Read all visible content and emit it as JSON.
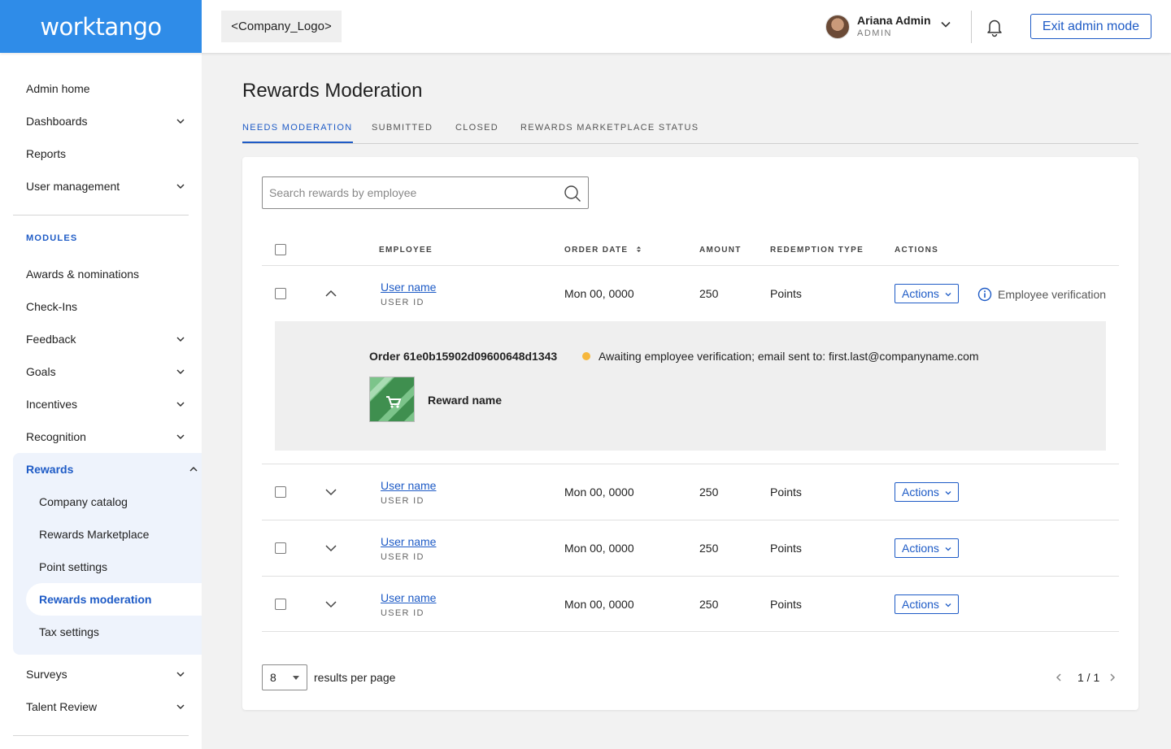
{
  "brand": {
    "name": "worktango"
  },
  "header": {
    "company_logo": "<Company_Logo>",
    "user": {
      "name": "Ariana Admin",
      "role": "ADMIN"
    },
    "exit_label": "Exit admin mode"
  },
  "sidebar": {
    "top_items": [
      {
        "label": "Admin home",
        "has_chevron": false
      },
      {
        "label": "Dashboards",
        "has_chevron": true
      },
      {
        "label": "Reports",
        "has_chevron": false
      },
      {
        "label": "User management",
        "has_chevron": true
      }
    ],
    "modules_label": "MODULES",
    "modules": [
      {
        "label": "Awards & nominations"
      },
      {
        "label": "Check-Ins"
      },
      {
        "label": "Feedback"
      },
      {
        "label": "Goals"
      },
      {
        "label": "Incentives"
      },
      {
        "label": "Recognition"
      }
    ],
    "rewards": {
      "label": "Rewards",
      "children": [
        "Company catalog",
        "Rewards Marketplace",
        "Point settings",
        "Rewards moderation",
        "Tax settings"
      ],
      "active_child": "Rewards moderation"
    },
    "after_items": [
      {
        "label": "Surveys"
      },
      {
        "label": "Talent Review"
      }
    ]
  },
  "page": {
    "title": "Rewards Moderation",
    "tabs": [
      "NEEDS MODERATION",
      "SUBMITTED",
      "CLOSED",
      "REWARDS MARKETPLACE STATUS"
    ],
    "active_tab": "NEEDS MODERATION",
    "search_placeholder": "Search rewards by employee"
  },
  "table": {
    "headers": {
      "employee": "EMPLOYEE",
      "order_date": "ORDER DATE",
      "amount": "AMOUNT",
      "redemption_type": "REDEMPTION TYPE",
      "actions": "ACTIONS"
    },
    "rows": [
      {
        "user_name": "User name",
        "user_id": "USER ID",
        "order_date": "Mon 00, 0000",
        "amount": "250",
        "redemption_type": "Points",
        "actions_label": "Actions",
        "expanded": true,
        "verification_label": "Employee verification"
      },
      {
        "user_name": "User name",
        "user_id": "USER ID",
        "order_date": "Mon 00, 0000",
        "amount": "250",
        "redemption_type": "Points",
        "actions_label": "Actions",
        "expanded": false
      },
      {
        "user_name": "User name",
        "user_id": "USER ID",
        "order_date": "Mon 00, 0000",
        "amount": "250",
        "redemption_type": "Points",
        "actions_label": "Actions",
        "expanded": false
      },
      {
        "user_name": "User name",
        "user_id": "USER ID",
        "order_date": "Mon 00, 0000",
        "amount": "250",
        "redemption_type": "Points",
        "actions_label": "Actions",
        "expanded": false
      }
    ],
    "expanded_detail": {
      "order": "Order 61e0b15902d09600648d1343",
      "status": "Awaiting employee verification; email sent to: first.last@companyname.com",
      "status_color": "#f6b73c",
      "reward_name": "Reward name"
    }
  },
  "pagination": {
    "per_page_value": "8",
    "per_page_label": "results per page",
    "page_indicator": "1 / 1"
  },
  "colors": {
    "brand": "#2f8ce8",
    "accent": "#1e5bc6",
    "background": "#f2f2f2",
    "status_pending": "#f6b73c"
  },
  "icons": [
    "chevron-down-icon",
    "chevron-up-icon",
    "bell-icon",
    "search-icon",
    "info-icon",
    "sort-icon",
    "cart-icon",
    "chevron-left-icon",
    "chevron-right-icon"
  ]
}
